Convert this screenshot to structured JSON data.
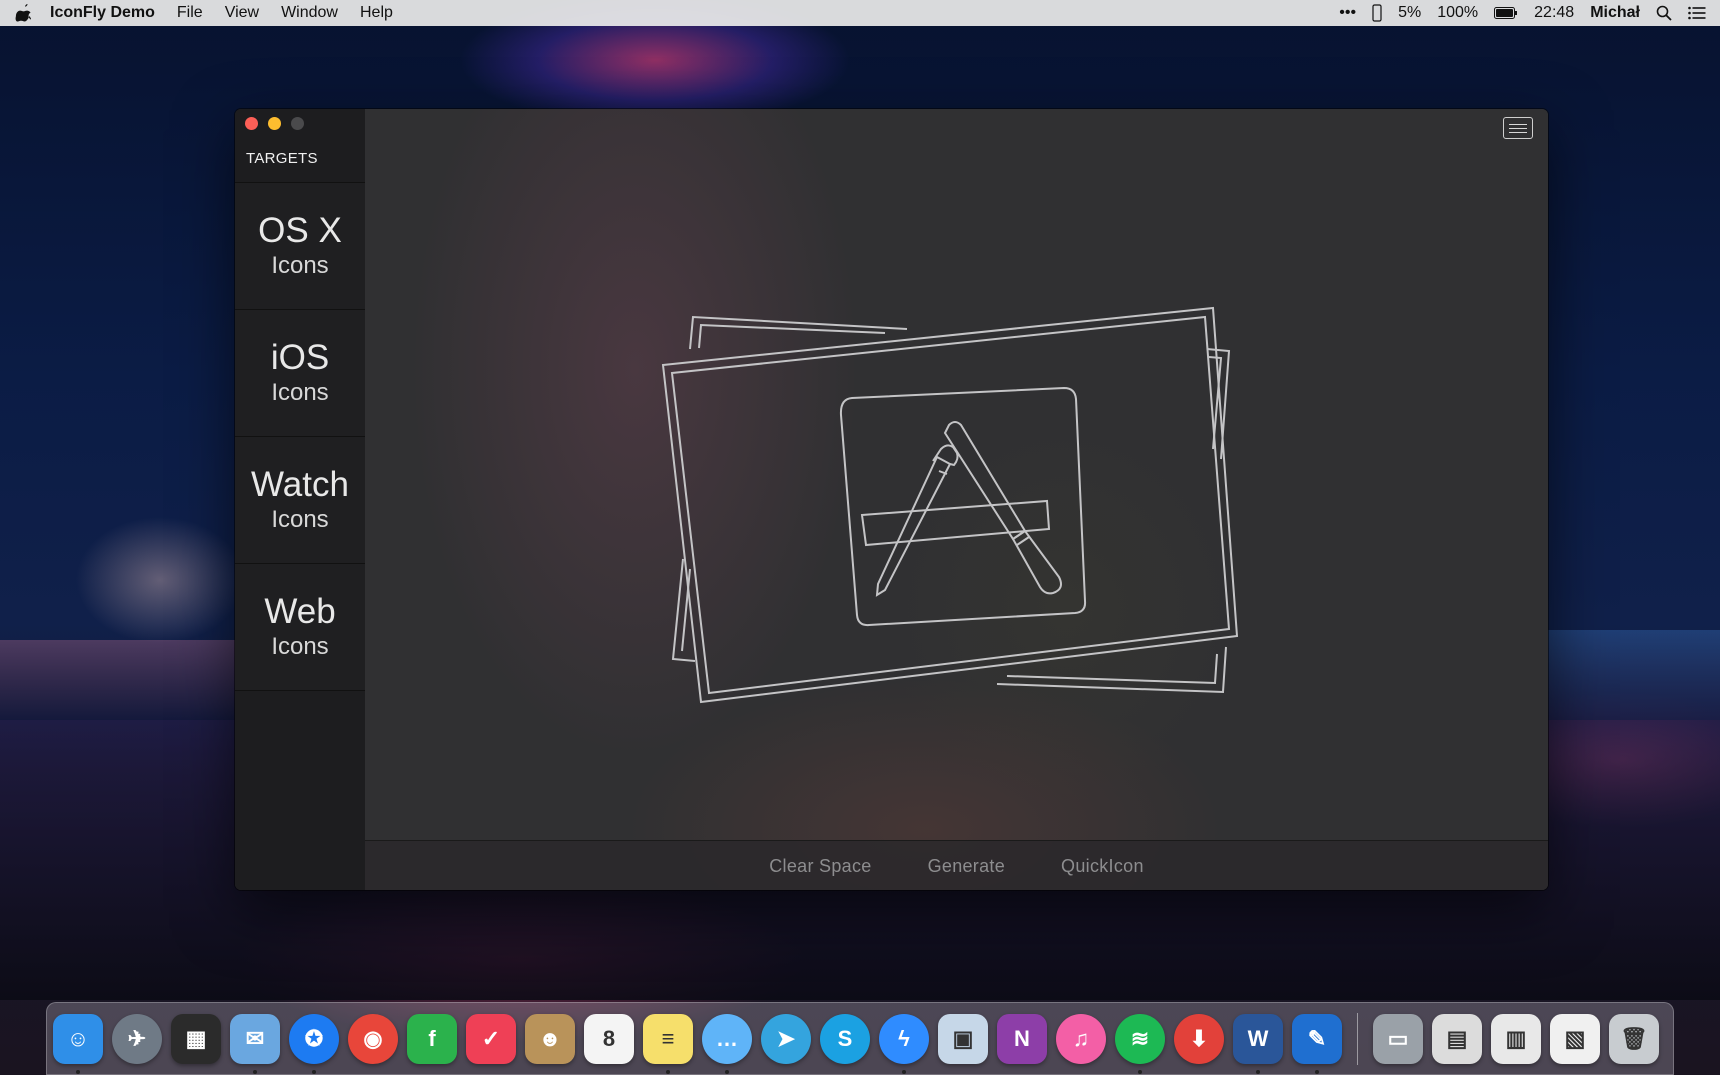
{
  "menubar": {
    "app_name": "IconFly Demo",
    "menus": [
      "File",
      "View",
      "Window",
      "Help"
    ],
    "status": {
      "more": "•••",
      "cpu": "5%",
      "battery": "100%",
      "time": "22:48",
      "user": "Michał"
    }
  },
  "window": {
    "sidebar": {
      "title": "TARGETS",
      "targets": [
        {
          "main": "OS X",
          "sub": "Icons"
        },
        {
          "main": "iOS",
          "sub": "Icons"
        },
        {
          "main": "Watch",
          "sub": "Icons"
        },
        {
          "main": "Web",
          "sub": "Icons"
        }
      ]
    },
    "actions": {
      "clear": "Clear Space",
      "generate": "Generate",
      "quickicon": "QuickIcon"
    }
  },
  "dock": {
    "apps": [
      {
        "icon": "finder-icon",
        "color": "#2f8fe8",
        "glyph": "☺",
        "running": true
      },
      {
        "icon": "launchpad-icon",
        "color": "#6f7a86",
        "glyph": "✈",
        "running": false
      },
      {
        "icon": "mission-control-icon",
        "color": "#2b2b2b",
        "glyph": "▦",
        "running": false
      },
      {
        "icon": "mail-icon",
        "color": "#6aa7e0",
        "glyph": "✉",
        "running": true
      },
      {
        "icon": "safari-icon",
        "color": "#1d7bf2",
        "glyph": "✪",
        "running": true
      },
      {
        "icon": "chrome-icon",
        "color": "#e8463a",
        "glyph": "◉",
        "running": false
      },
      {
        "icon": "feedly-icon",
        "color": "#2bb24c",
        "glyph": "f",
        "running": false
      },
      {
        "icon": "pocket-icon",
        "color": "#ef4056",
        "glyph": "✓",
        "running": false
      },
      {
        "icon": "contacts-icon",
        "color": "#b9935a",
        "glyph": "☻",
        "running": false
      },
      {
        "icon": "calendar-icon",
        "color": "#f4f4f4",
        "glyph": "8",
        "running": false
      },
      {
        "icon": "notes-icon",
        "color": "#f6df6b",
        "glyph": "≡",
        "running": true
      },
      {
        "icon": "messages-icon",
        "color": "#5fb4f8",
        "glyph": "…",
        "running": true
      },
      {
        "icon": "telegram-icon",
        "color": "#34a4de",
        "glyph": "➤",
        "running": false
      },
      {
        "icon": "skype-icon",
        "color": "#1ba1e2",
        "glyph": "S",
        "running": false
      },
      {
        "icon": "messenger-icon",
        "color": "#2f8cff",
        "glyph": "ϟ",
        "running": true
      },
      {
        "icon": "preview-icon",
        "color": "#c6d7e8",
        "glyph": "▣",
        "running": false
      },
      {
        "icon": "onenote-icon",
        "color": "#8d3ea8",
        "glyph": "N",
        "running": false
      },
      {
        "icon": "itunes-icon",
        "color": "#f35fa6",
        "glyph": "♫",
        "running": false
      },
      {
        "icon": "spotify-icon",
        "color": "#1db954",
        "glyph": "≋",
        "running": true
      },
      {
        "icon": "transmission-icon",
        "color": "#e2413a",
        "glyph": "⬇",
        "running": false
      },
      {
        "icon": "word-icon",
        "color": "#2a5699",
        "glyph": "W",
        "running": true
      },
      {
        "icon": "xcode-icon",
        "color": "#1f6fd0",
        "glyph": "✎",
        "running": true
      }
    ],
    "docs": [
      {
        "icon": "folder-icon",
        "color": "#9aa1a8",
        "glyph": "▭"
      },
      {
        "icon": "document-stack-icon",
        "color": "#dcdcdc",
        "glyph": "▤"
      },
      {
        "icon": "document-stack-icon",
        "color": "#e8e8e8",
        "glyph": "▥"
      },
      {
        "icon": "document-stack-icon",
        "color": "#f0f0f0",
        "glyph": "▧"
      },
      {
        "icon": "trash-icon",
        "color": "#c8ccd0",
        "glyph": "🗑"
      }
    ]
  }
}
